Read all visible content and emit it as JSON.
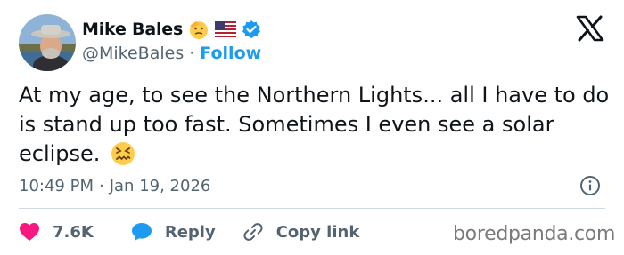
{
  "author": {
    "display_name": "Mike Bales",
    "handle": "@MikeBales",
    "separator": "·",
    "follow_label": "Follow",
    "name_emojis": [
      "saluting-face-emoji",
      "us-flag-emoji"
    ],
    "verified": true,
    "verified_color": "#1d9bf0"
  },
  "tweet": {
    "text": "At my age, to see the Northern Lights... all I have to do is stand up too fast. Sometimes I even see a solar eclipse.",
    "trailing_emoji": "confounded-face-emoji",
    "time": "10:49 PM",
    "date": "Jan 19, 2026",
    "meta_separator": "·"
  },
  "actions": {
    "like_count": "7.6K",
    "reply_label": "Reply",
    "copy_label": "Copy link",
    "like_color": "#f91880",
    "reply_color": "#1d9bf0"
  },
  "watermark": "boredpanda.com",
  "colors": {
    "text": "#0f1419",
    "secondary": "#536471",
    "accent": "#1d9bf0",
    "divider": "#cfd9de"
  }
}
